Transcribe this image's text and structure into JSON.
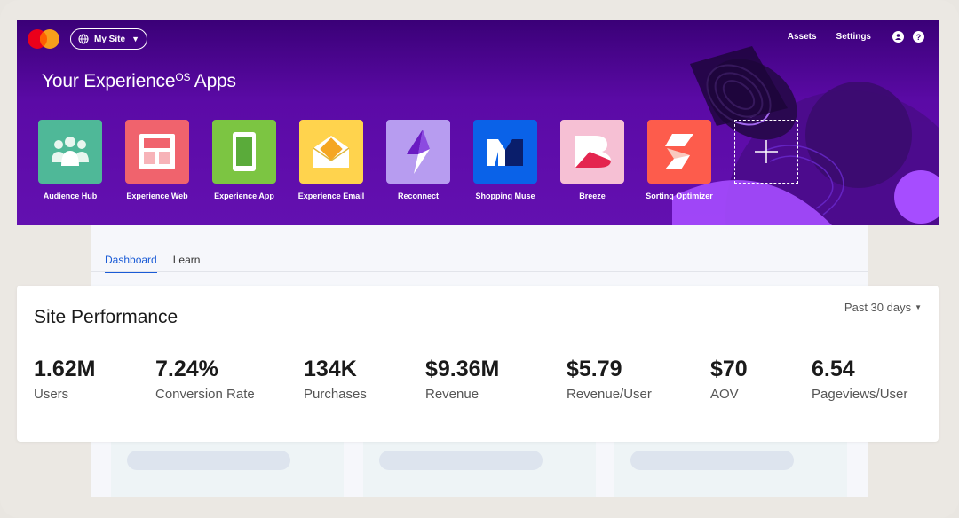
{
  "header": {
    "site_switcher": "My Site",
    "links": [
      "Assets",
      "Settings"
    ],
    "title_main": "Your Experience",
    "title_sup": "OS",
    "title_end": " Apps",
    "colors": {
      "background": "#5b0aa6",
      "accent": "#a64dff"
    }
  },
  "apps": [
    {
      "label": "Audience Hub",
      "icon": "audience-icon",
      "color": "#4fb898"
    },
    {
      "label": "Experience Web",
      "icon": "web-layout-icon",
      "color": "#f0636d"
    },
    {
      "label": "Experience App",
      "icon": "mobile-app-icon",
      "color": "#7cc542"
    },
    {
      "label": "Experience Email",
      "icon": "email-icon",
      "color": "#ffd34d"
    },
    {
      "label": "Reconnect",
      "icon": "lightning-icon",
      "color": "#b79cf0"
    },
    {
      "label": "Shopping Muse",
      "icon": "muse-icon",
      "color": "#0a62e8"
    },
    {
      "label": "Breeze",
      "icon": "breeze-icon",
      "color": "#f6c0d4"
    },
    {
      "label": "Sorting Optimizer",
      "icon": "sorting-icon",
      "color": "#fd5c4c"
    }
  ],
  "tabs": [
    "Dashboard",
    "Learn"
  ],
  "performance": {
    "title": "Site Performance",
    "period": "Past 30 days",
    "metrics": [
      {
        "value": "1.62M",
        "label": "Users"
      },
      {
        "value": "7.24%",
        "label": "Conversion Rate"
      },
      {
        "value": "134K",
        "label": "Purchases"
      },
      {
        "value": "$9.36M",
        "label": "Revenue"
      },
      {
        "value": "$5.79",
        "label": "Revenue/User"
      },
      {
        "value": "$70",
        "label": "AOV"
      },
      {
        "value": "6.54",
        "label": "Pageviews/User"
      }
    ]
  }
}
